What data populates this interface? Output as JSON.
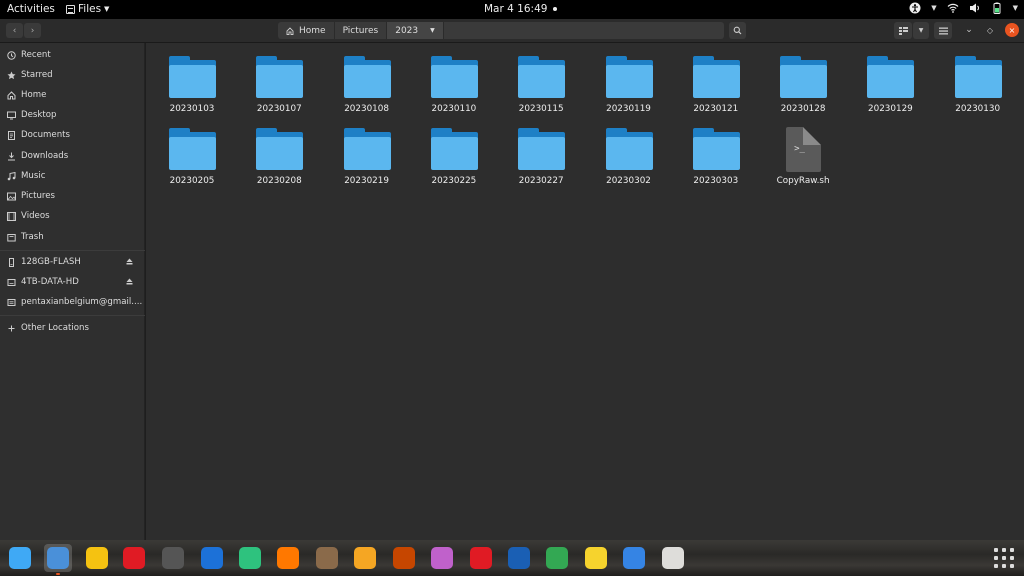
{
  "topbar": {
    "activities": "Activities",
    "app_name": "Files",
    "clock": "Mar 4  16:49"
  },
  "breadcrumb": {
    "items": [
      {
        "label": "Home"
      },
      {
        "label": "Pictures"
      },
      {
        "label": "2023"
      }
    ]
  },
  "sidebar": {
    "places": [
      {
        "label": "Recent",
        "icon": "clock-icon"
      },
      {
        "label": "Starred",
        "icon": "star-icon"
      },
      {
        "label": "Home",
        "icon": "home-icon"
      },
      {
        "label": "Desktop",
        "icon": "desktop-icon"
      },
      {
        "label": "Documents",
        "icon": "document-icon"
      },
      {
        "label": "Downloads",
        "icon": "download-icon"
      },
      {
        "label": "Music",
        "icon": "music-icon"
      },
      {
        "label": "Pictures",
        "icon": "picture-icon"
      },
      {
        "label": "Videos",
        "icon": "video-icon"
      },
      {
        "label": "Trash",
        "icon": "trash-icon"
      }
    ],
    "devices": [
      {
        "label": "128GB-FLASH",
        "icon": "drive-icon",
        "eject": true
      },
      {
        "label": "4TB-DATA-HD",
        "icon": "drive-icon",
        "eject": true
      },
      {
        "label": "pentaxianbelgium@gmail....",
        "icon": "network-drive-icon",
        "eject": false
      }
    ],
    "other": {
      "label": "Other Locations",
      "icon": "plus-icon"
    }
  },
  "files": [
    {
      "name": "20230103",
      "type": "folder"
    },
    {
      "name": "20230107",
      "type": "folder"
    },
    {
      "name": "20230108",
      "type": "folder"
    },
    {
      "name": "20230110",
      "type": "folder"
    },
    {
      "name": "20230115",
      "type": "folder"
    },
    {
      "name": "20230119",
      "type": "folder"
    },
    {
      "name": "20230121",
      "type": "folder"
    },
    {
      "name": "20230128",
      "type": "folder"
    },
    {
      "name": "20230129",
      "type": "folder"
    },
    {
      "name": "20230130",
      "type": "folder"
    },
    {
      "name": "20230205",
      "type": "folder"
    },
    {
      "name": "20230208",
      "type": "folder"
    },
    {
      "name": "20230219",
      "type": "folder"
    },
    {
      "name": "20230225",
      "type": "folder"
    },
    {
      "name": "20230227",
      "type": "folder"
    },
    {
      "name": "20230302",
      "type": "folder"
    },
    {
      "name": "20230303",
      "type": "folder"
    },
    {
      "name": "CopyRaw.sh",
      "type": "script"
    }
  ],
  "dock": {
    "apps": [
      {
        "name": "pie-chart-app-icon",
        "color": "#3fa9f5"
      },
      {
        "name": "files-app-icon",
        "color": "#4a90d9",
        "active": true
      },
      {
        "name": "rhythmbox-icon",
        "color": "#f5c211"
      },
      {
        "name": "help-lifebuoy-icon",
        "color": "#e01b24"
      },
      {
        "name": "blank-app-icon",
        "color": "#555555"
      },
      {
        "name": "book-app-icon",
        "color": "#1c71d8"
      },
      {
        "name": "photo-app-icon",
        "color": "#2ec27e"
      },
      {
        "name": "color-wheel-icon",
        "color": "#ff7800"
      },
      {
        "name": "gimp-icon",
        "color": "#8a6a4a"
      },
      {
        "name": "music-disc-icon",
        "color": "#f5a623"
      },
      {
        "name": "image-viewer-icon",
        "color": "#c64600"
      },
      {
        "name": "screenshot-app-icon",
        "color": "#c061cb"
      },
      {
        "name": "card-reader-icon",
        "color": "#e01b24"
      },
      {
        "name": "thunderbird-icon",
        "color": "#1a5fb4"
      },
      {
        "name": "chrome-icon",
        "color": "#33a853"
      },
      {
        "name": "text-editor-icon",
        "color": "#f6d32d"
      },
      {
        "name": "usb-app-icon",
        "color": "#3584e4"
      },
      {
        "name": "disk-app-icon",
        "color": "#deddda"
      }
    ]
  }
}
